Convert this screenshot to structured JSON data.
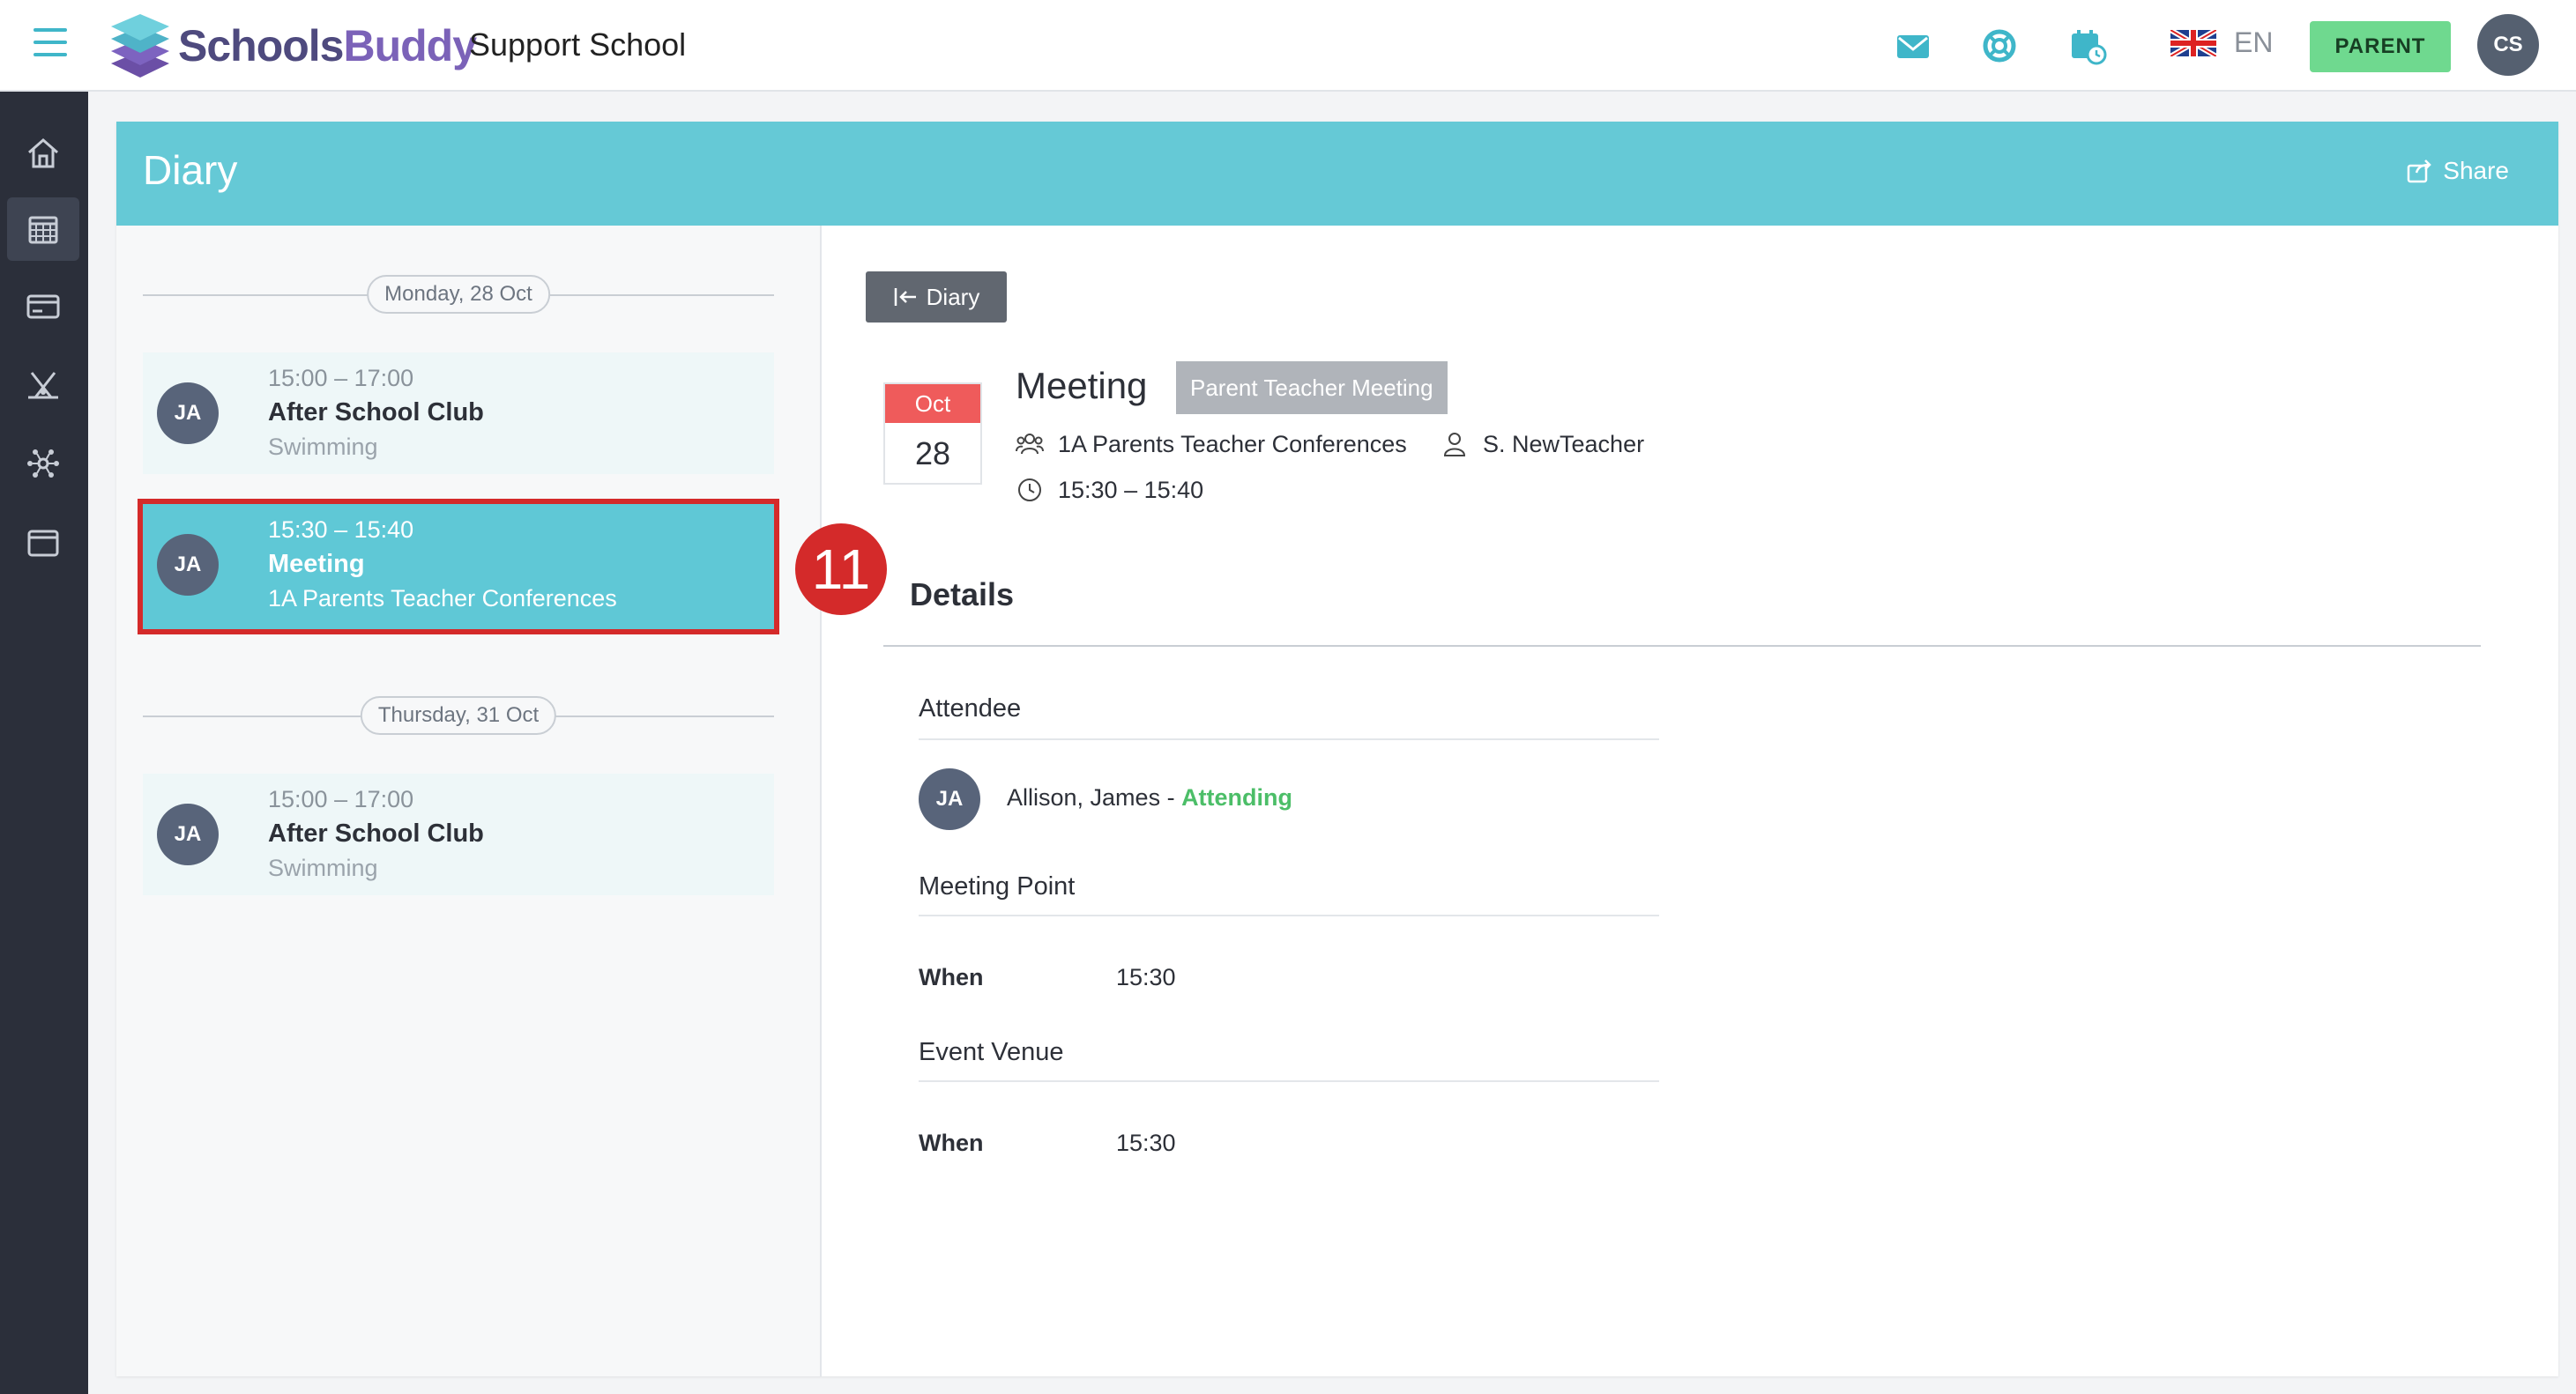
{
  "app": {
    "brand_part1": "Schools",
    "brand_part2": "Buddy",
    "school_name": "Support School",
    "language": "EN",
    "role_button": "PARENT",
    "user_initials": "CS"
  },
  "icons": {
    "menu": "hamburger-icon",
    "mail": "mail-icon",
    "help": "lifebuoy-icon",
    "calendar_alert": "calendar-clock-icon",
    "flag": "uk-flag-icon",
    "share": "share-icon",
    "back": "arrow-left-bar-icon",
    "group": "group-icon",
    "person": "person-icon",
    "clock": "clock-icon"
  },
  "sidebar": {
    "items": [
      {
        "name": "home-icon",
        "active": false
      },
      {
        "name": "calendar-icon",
        "active": true
      },
      {
        "name": "card-icon",
        "active": false
      },
      {
        "name": "activities-icon",
        "active": false
      },
      {
        "name": "network-icon",
        "active": false
      },
      {
        "name": "window-icon",
        "active": false
      }
    ]
  },
  "page": {
    "title": "Diary",
    "share_label": "Share"
  },
  "diary": {
    "groups": [
      {
        "date": "Monday, 28 Oct",
        "events": [
          {
            "initials": "JA",
            "time": "15:00 – 17:00",
            "title": "After School Club",
            "subtitle": "Swimming",
            "selected": false
          },
          {
            "initials": "JA",
            "time": "15:30 – 15:40",
            "title": "Meeting",
            "subtitle": "1A Parents Teacher Conferences",
            "selected": true
          }
        ]
      },
      {
        "date": "Thursday, 31 Oct",
        "events": [
          {
            "initials": "JA",
            "time": "15:00 – 17:00",
            "title": "After School Club",
            "subtitle": "Swimming",
            "selected": false
          }
        ]
      }
    ]
  },
  "annotation": {
    "step_number": "11"
  },
  "detail": {
    "back_label": "Diary",
    "month": "Oct",
    "day": "28",
    "title": "Meeting",
    "tag": "Parent Teacher Meeting",
    "group": "1A Parents Teacher Conferences",
    "teacher": "S. NewTeacher",
    "time": "15:30 – 15:40",
    "details_heading": "Details",
    "attendee_label": "Attendee",
    "attendee_initials": "JA",
    "attendee_name": "Allison, James - ",
    "attendee_status": "Attending",
    "meeting_point_label": "Meeting Point",
    "meeting_point_when_key": "When",
    "meeting_point_when_val": "15:30",
    "venue_label": "Event Venue",
    "venue_when_key": "When",
    "venue_when_val": "15:30"
  },
  "colors": {
    "accent": "#65c9d6",
    "selected": "#5fc8d6",
    "highlight": "#d42a2a",
    "attending": "#4cbe68",
    "role_button": "#6fd98f",
    "sidebar": "#2b2f3a",
    "calendar_red": "#ef5b5b"
  }
}
